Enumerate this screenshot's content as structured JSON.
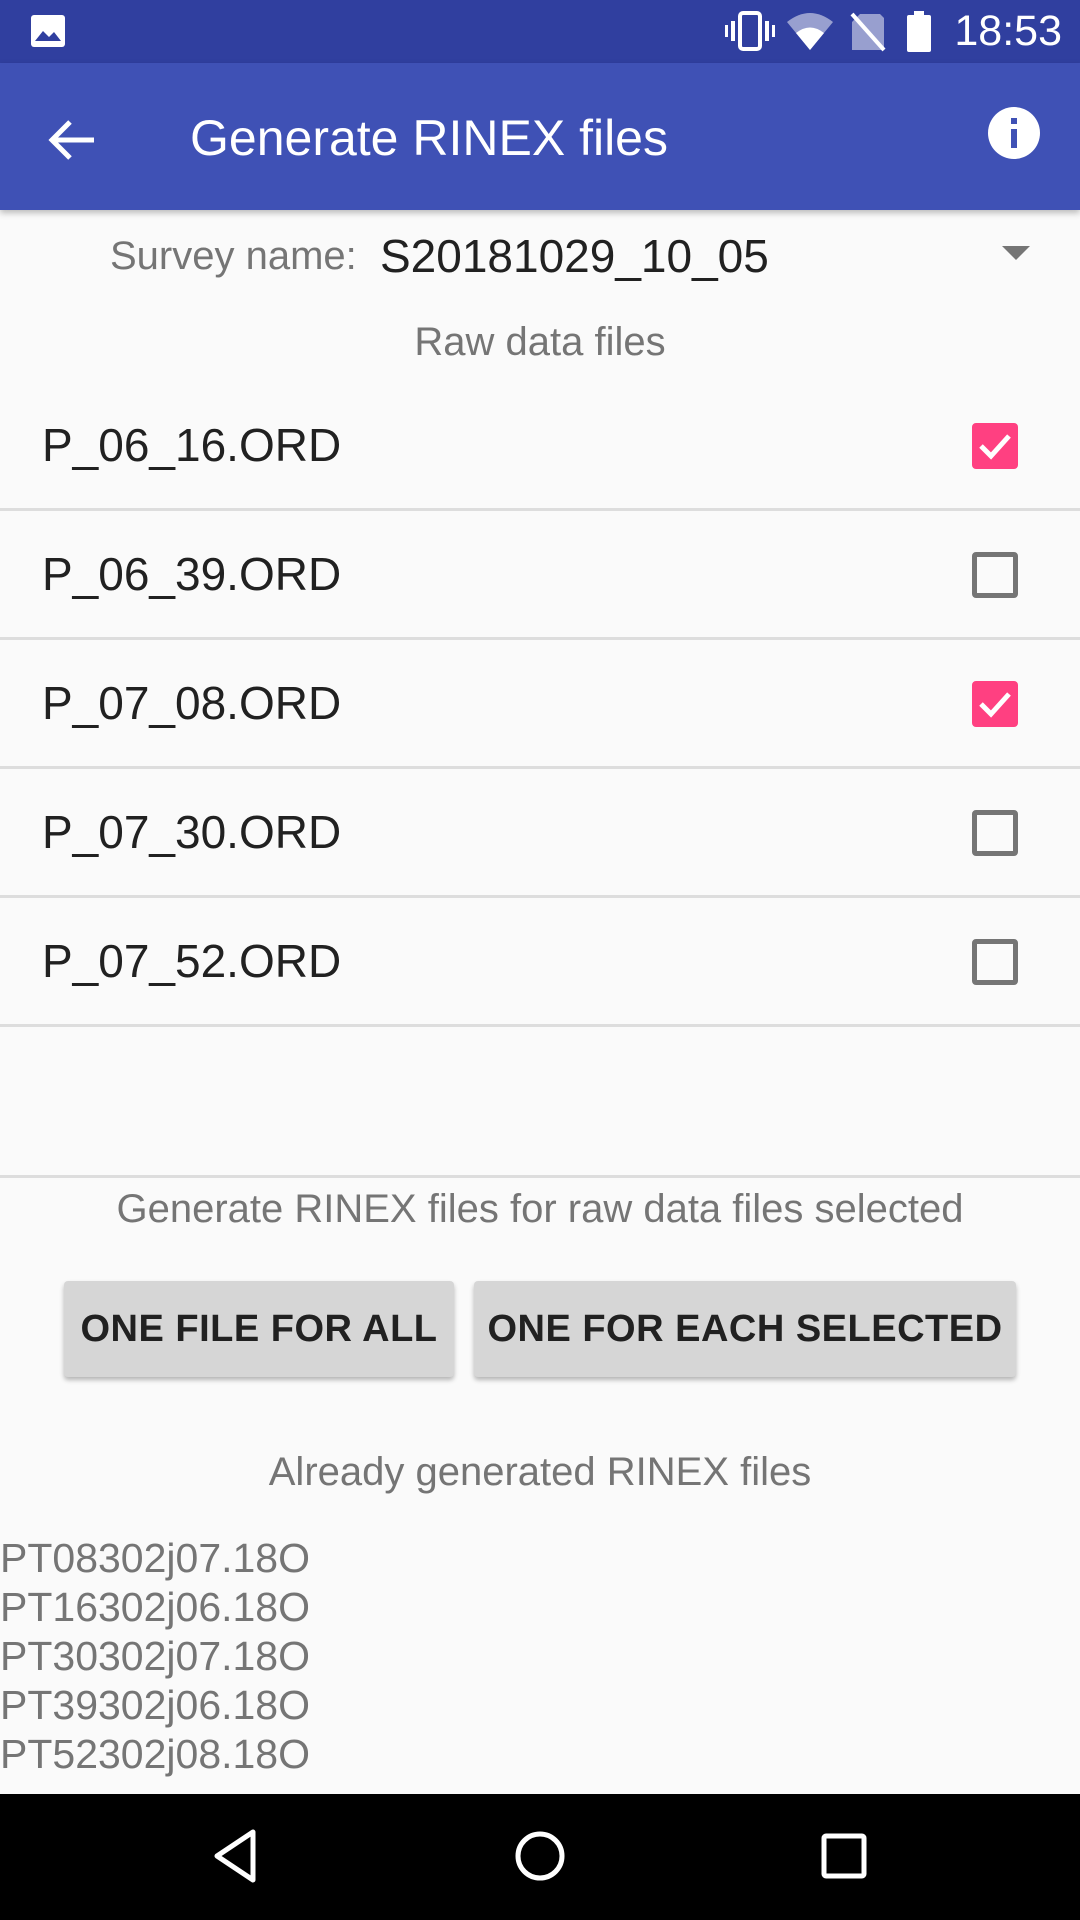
{
  "status_bar": {
    "time": "18:53",
    "icons": [
      "gallery-icon",
      "vibrate-icon",
      "wifi-icon",
      "no-sim-icon",
      "battery-icon"
    ]
  },
  "app_bar": {
    "title": "Generate RINEX files",
    "left_icon": "arrow-back-icon",
    "right_icon": "info-icon"
  },
  "survey": {
    "label": "Survey name:",
    "selected": "S20181029_10_05"
  },
  "raw_section": {
    "heading": "Raw data files",
    "files": [
      {
        "name": "P_06_16.ORD",
        "checked": true
      },
      {
        "name": "P_06_39.ORD",
        "checked": false
      },
      {
        "name": "P_07_08.ORD",
        "checked": true
      },
      {
        "name": "P_07_30.ORD",
        "checked": false
      },
      {
        "name": "P_07_52.ORD",
        "checked": false
      }
    ]
  },
  "generate_section": {
    "heading": "Generate RINEX files for raw data files selected",
    "one_file_button": "ONE FILE FOR ALL",
    "each_selected_button": "ONE FOR EACH SELECTED"
  },
  "generated_section": {
    "heading": "Already generated RINEX files",
    "files": [
      "PT08302j07.18O",
      "PT16302j06.18O",
      "PT30302j07.18O",
      "PT39302j06.18O",
      "PT52302j08.18O"
    ]
  },
  "nav_bar": {
    "icons": [
      "nav-back-icon",
      "nav-home-icon",
      "nav-recents-icon"
    ]
  },
  "colors": {
    "status_bar": "#303f9f",
    "app_bar": "#3f51b5",
    "accent": "#ff4081",
    "background": "#fafafa",
    "button": "#d6d6d6"
  }
}
